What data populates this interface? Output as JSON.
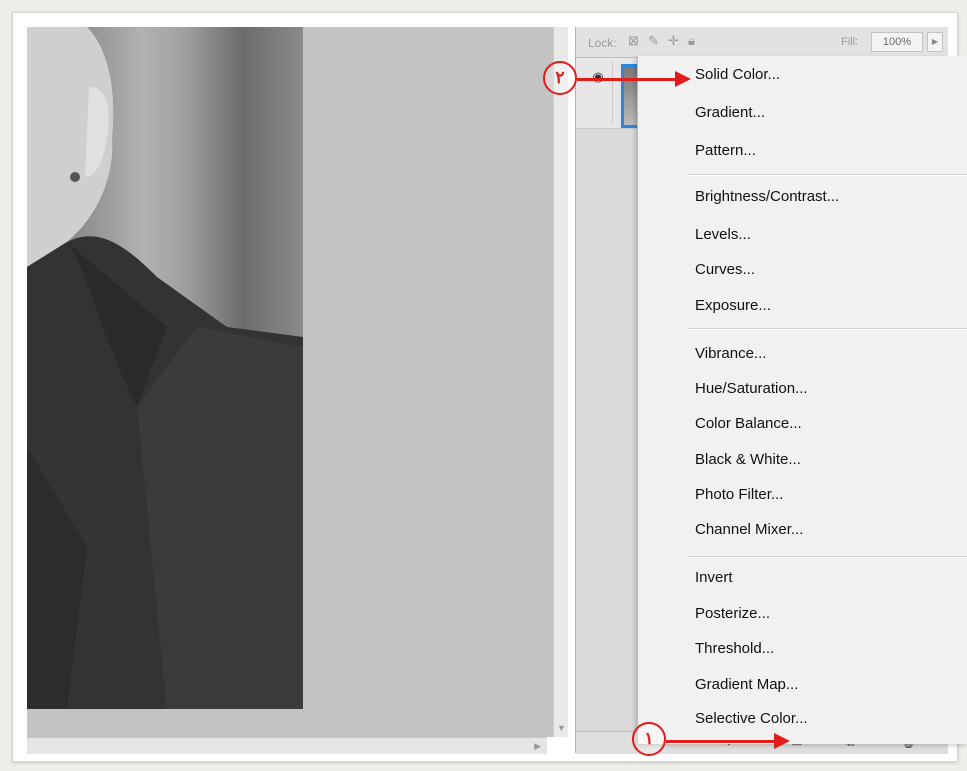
{
  "layers_panel": {
    "lock_label": "Lock:",
    "fill_label": "Fill:",
    "fill_value": "100%"
  },
  "adjustment_menu": {
    "groups": [
      [
        "Solid Color...",
        "Gradient...",
        "Pattern..."
      ],
      [
        "Brightness/Contrast...",
        "Levels...",
        "Curves...",
        "Exposure..."
      ],
      [
        "Vibrance...",
        "Hue/Saturation...",
        "Color Balance...",
        "Black & White...",
        "Photo Filter...",
        "Channel Mixer..."
      ],
      [
        "Invert",
        "Posterize...",
        "Threshold...",
        "Gradient Map...",
        "Selective Color..."
      ]
    ]
  },
  "annotations": {
    "step1": "۱",
    "step2": "۲",
    "color": "#e21b1b"
  },
  "icons": {
    "eye": "eye-icon",
    "lock_transparent": "lock-transparent-icon",
    "lock_brush": "lock-brush-icon",
    "lock_move": "lock-move-icon",
    "lock_all": "lock-all-icon"
  }
}
